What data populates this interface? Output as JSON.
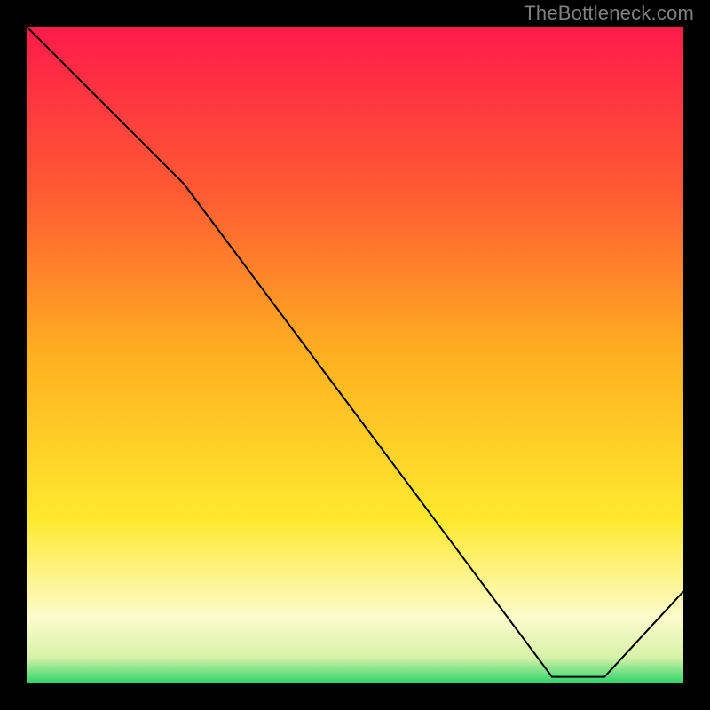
{
  "attribution": "TheBottleneck.com",
  "chart_data": {
    "type": "line",
    "x": [
      0.0,
      0.24,
      0.8,
      0.88,
      1.0
    ],
    "y": [
      1.0,
      0.76,
      0.01,
      0.01,
      0.14
    ],
    "xlim": [
      0,
      1
    ],
    "ylim": [
      0,
      1
    ],
    "title": "",
    "xlabel": "",
    "ylabel": "",
    "annotation": {
      "text": "",
      "x": 0.8,
      "y": 0.015
    },
    "background": {
      "type": "vertical-gradient",
      "stops": [
        {
          "offset": 0.0,
          "color": "#ff1a4a"
        },
        {
          "offset": 0.25,
          "color": "#ff5a33"
        },
        {
          "offset": 0.5,
          "color": "#ffb020"
        },
        {
          "offset": 0.75,
          "color": "#ffe92e"
        },
        {
          "offset": 0.9,
          "color": "#fcfccd"
        },
        {
          "offset": 0.96,
          "color": "#d8f2a8"
        },
        {
          "offset": 1.0,
          "color": "#2bd46b"
        }
      ]
    },
    "line_color": "#000000",
    "line_width": 2
  }
}
